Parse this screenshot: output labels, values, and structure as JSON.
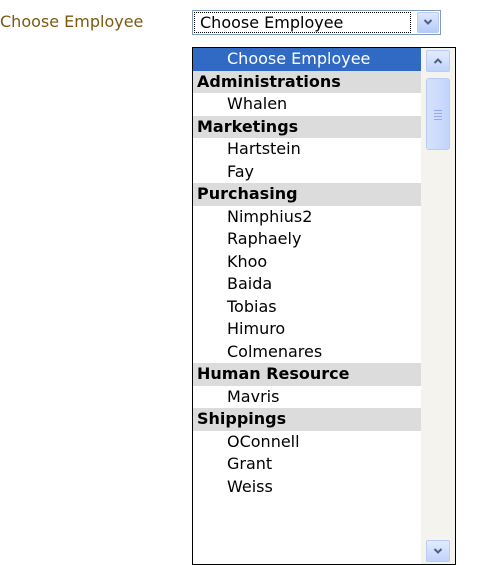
{
  "form": {
    "label": "Choose Employee",
    "selected_value": "Choose Employee"
  },
  "dropdown": {
    "rows": [
      {
        "type": "selected",
        "label": "Choose Employee"
      },
      {
        "type": "group",
        "label": "Administrations"
      },
      {
        "type": "item",
        "label": "Whalen"
      },
      {
        "type": "group",
        "label": "Marketings"
      },
      {
        "type": "item",
        "label": "Hartstein"
      },
      {
        "type": "item",
        "label": "Fay"
      },
      {
        "type": "group",
        "label": "Purchasing"
      },
      {
        "type": "item",
        "label": "Nimphius2"
      },
      {
        "type": "item",
        "label": "Raphaely"
      },
      {
        "type": "item",
        "label": "Khoo"
      },
      {
        "type": "item",
        "label": "Baida"
      },
      {
        "type": "item",
        "label": "Tobias"
      },
      {
        "type": "item",
        "label": "Himuro"
      },
      {
        "type": "item",
        "label": "Colmenares"
      },
      {
        "type": "group",
        "label": "Human Resource"
      },
      {
        "type": "item",
        "label": "Mavris"
      },
      {
        "type": "group",
        "label": "Shippings"
      },
      {
        "type": "item",
        "label": "OConnell"
      },
      {
        "type": "item",
        "label": "Grant"
      },
      {
        "type": "item",
        "label": "Weiss"
      }
    ]
  },
  "colors": {
    "label_text": "#7a5a12",
    "selection": "#316ac5",
    "group_header_bg": "#dcdcdc",
    "scroll_button": "#c1d3fb"
  },
  "icons": {
    "combo_button": "chevron-down-icon",
    "scroll_up": "arrow-up-icon",
    "scroll_down": "arrow-down-icon"
  }
}
